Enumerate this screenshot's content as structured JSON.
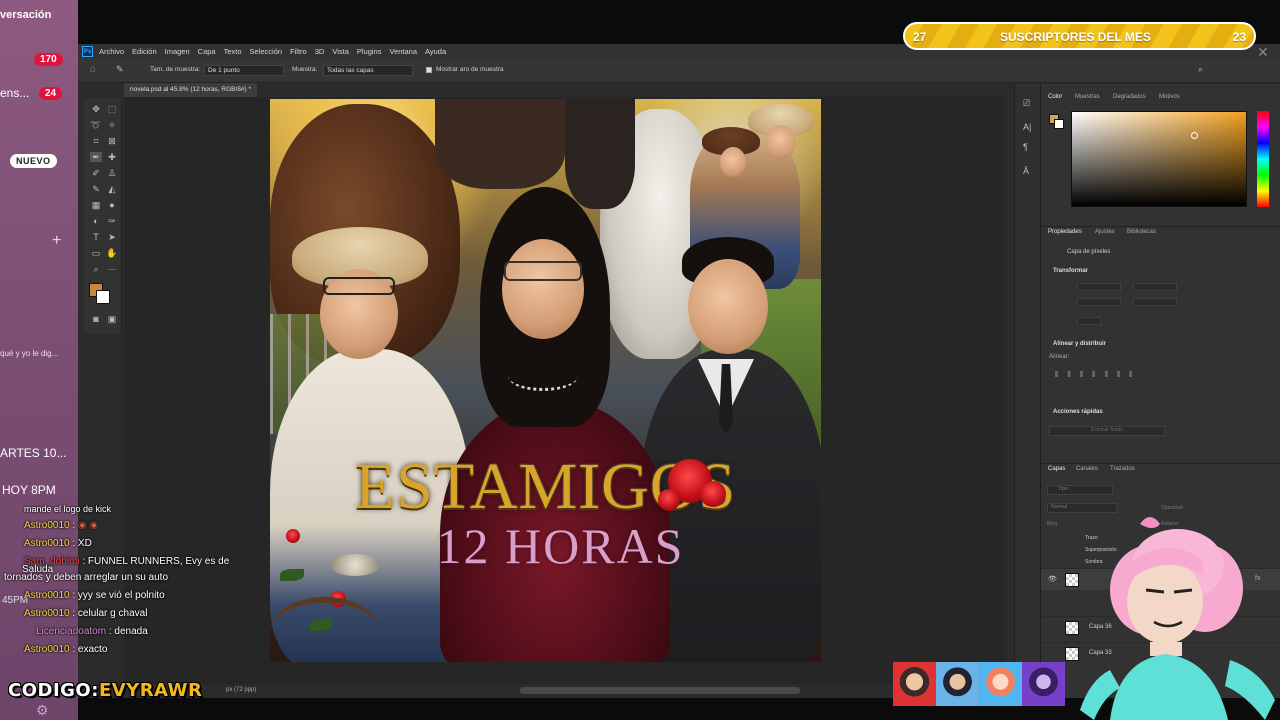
{
  "sidebar": {
    "conversation_label": "versación",
    "badge_1": "170",
    "item_2": "ens...",
    "badge_2": "24",
    "nuevo": "NUEVO",
    "snippet": "qué y yo le dig...",
    "partes": "ARTES 10...",
    "hoy": "HOY 8PM",
    "saluda": "Saluda",
    "date": "45PM"
  },
  "banner": {
    "left_num": "27",
    "title": "SUSCRIPTORES DEL MES",
    "right_num": "23"
  },
  "photoshop": {
    "menu": [
      "Archivo",
      "Edición",
      "Imagen",
      "Capa",
      "Texto",
      "Selección",
      "Filtro",
      "3D",
      "Vista",
      "Plugins",
      "Ventana",
      "Ayuda"
    ],
    "options": {
      "sample_size_label": "Tam. de muestra:",
      "sample_size_value": "De 1 punto",
      "sample_label": "Muestra:",
      "sample_value": "Todas las capas",
      "show_ring": "Mostrar aro de muestra"
    },
    "doc_tab": "novela.psd al 45.8% (12 horas, RGB/8#) *",
    "status": "px (72 ppp)",
    "color_tabs": [
      "Color",
      "Muestras",
      "Degradados",
      "Motivos"
    ],
    "props_tabs": [
      "Propiedades",
      "Ajustes",
      "Bibliotecas"
    ],
    "pixel_layer": "Capa de píxeles",
    "transform": "Transformar",
    "align": "Alinear y distribuir",
    "align_sub": "Alinear:",
    "quick": "Acciones rápidas",
    "quick_btn": "Eliminar fondo",
    "layers_tabs": [
      "Capas",
      "Canales",
      "Trazados"
    ],
    "layer_search": "Tipo",
    "blend": "Normal",
    "opacity": "Opacidad:",
    "lock": "Bloq.:",
    "fill": "Relleno:",
    "effects": [
      "Trazo",
      "Superposición",
      "Sombra"
    ],
    "layers": [
      "Capa 36",
      "Capa 33"
    ],
    "fx": "fx"
  },
  "poster": {
    "title": "ESTAMIGOS",
    "subtitle": "12 HORAS"
  },
  "chat": [
    {
      "user": "",
      "text": "mande el logo de kick"
    },
    {
      "user": "Astro0010",
      "text": ":"
    },
    {
      "user": "Astro0010",
      "text": ": XD"
    },
    {
      "user": "Sam_dohimi",
      "text": ": FUNNEL RUNNERS, Evy es de"
    },
    {
      "user": "",
      "text": "tornados y deben arreglar un su auto"
    },
    {
      "user": "Astro0010",
      "text": ": yyy se vió el polnito"
    },
    {
      "user": "Astro0010",
      "text": ": celular g chaval"
    },
    {
      "user": "Licenciadoatom",
      "text": ": denada"
    },
    {
      "user": "Astro0010",
      "text": ": exacto"
    }
  ],
  "codigo": {
    "prefix": "CODIGO:",
    "code": "EVYRAWR"
  },
  "colors": {
    "accent_orange": "#f2c31b",
    "fg_swatch": "#c88a3a",
    "rose": "#c4101a",
    "title_gold": "#d9a42a",
    "subtitle_pink": "#d89fc7"
  },
  "icons": [
    "eyedropper-icon",
    "home-icon",
    "search-icon",
    "close-icon",
    "rose-icon",
    "eye-icon"
  ]
}
